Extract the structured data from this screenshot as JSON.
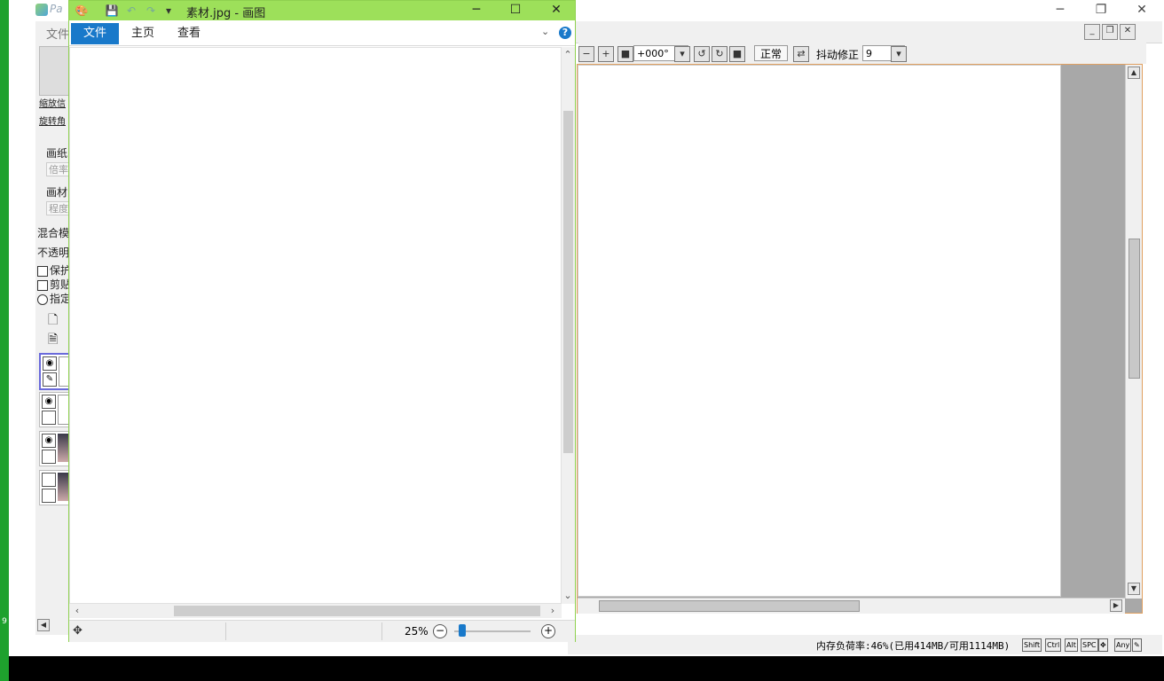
{
  "sai": {
    "logo_text": "Pa",
    "menu_file": "文件",
    "window_controls": [
      "─",
      "❐",
      "✕"
    ],
    "mdi_controls": [
      "_",
      "❐",
      "✕"
    ],
    "left_panel": {
      "btn_zoom": "缩放信",
      "btn_rotate": "旋转角",
      "paper_label": "画纸",
      "paper_field": "倍率",
      "material_label": "画材",
      "material_field": "程度",
      "blend_label": "混合模",
      "opacity_label": "不透明",
      "check_protect": "保护",
      "check_clip": "剪贴",
      "radio_specify": "指定"
    },
    "toolbar": {
      "angle_value": "+000°",
      "mode_button": "正常",
      "stabilizer_label": "抖动修正",
      "stabilizer_value": "9"
    },
    "status": {
      "memory": "内存负荷率:46%(已用414MB/可用1114MB)",
      "modifier_keys": [
        "Shift",
        "Ctrl",
        "Alt",
        "SPC",
        "✥",
        "Any",
        "✎"
      ]
    }
  },
  "paint": {
    "title": "素材.jpg - 画图",
    "window_controls": [
      "─",
      "☐",
      "✕"
    ],
    "tabs": [
      {
        "label": "文件",
        "active": true
      },
      {
        "label": "主页",
        "active": false
      },
      {
        "label": "查看",
        "active": false
      }
    ],
    "zoom_level": "25%",
    "zoom_fraction": 0.1
  },
  "desktop": {
    "side_mark": "9"
  },
  "colors": {
    "paint_title_bar": "#9de05a",
    "ribbon_accent": "#1979ca",
    "desktop_green": "#1ea12d",
    "sai_canvas_border": "#e0a060"
  }
}
